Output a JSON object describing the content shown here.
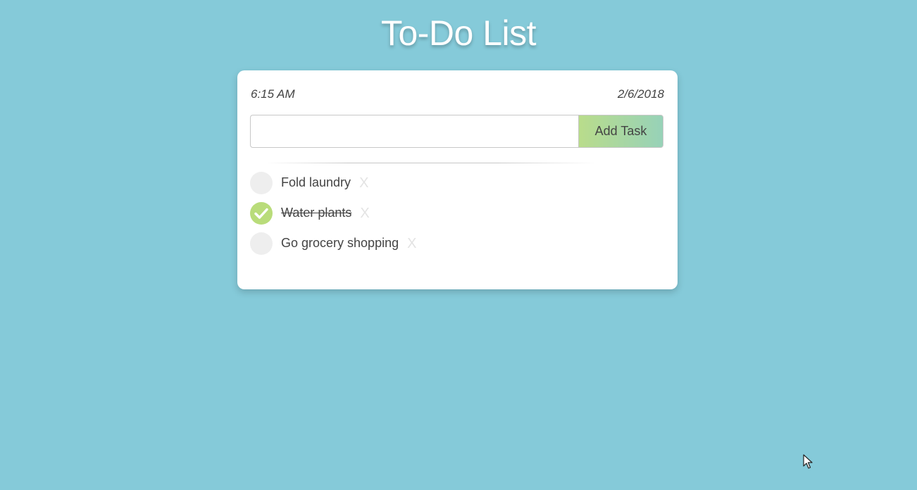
{
  "header": {
    "title": "To-Do List"
  },
  "card": {
    "time": "6:15 AM",
    "date": "2/6/2018",
    "input": {
      "value": "",
      "placeholder": ""
    },
    "add_button_label": "Add Task",
    "delete_glyph": "X",
    "tasks": [
      {
        "label": "Fold laundry",
        "done": false
      },
      {
        "label": "Water plants",
        "done": true
      },
      {
        "label": "Go grocery shopping",
        "done": false
      }
    ]
  },
  "colors": {
    "background": "#85cad9",
    "check_done": "#b9dc7a",
    "check_empty": "#eeeeee",
    "button_gradient_start": "#b9dc8b",
    "button_gradient_end": "#97d2b8"
  },
  "icons": {
    "check": "checkmark-icon",
    "delete": "close-icon",
    "cursor": "mouse-pointer-icon"
  }
}
